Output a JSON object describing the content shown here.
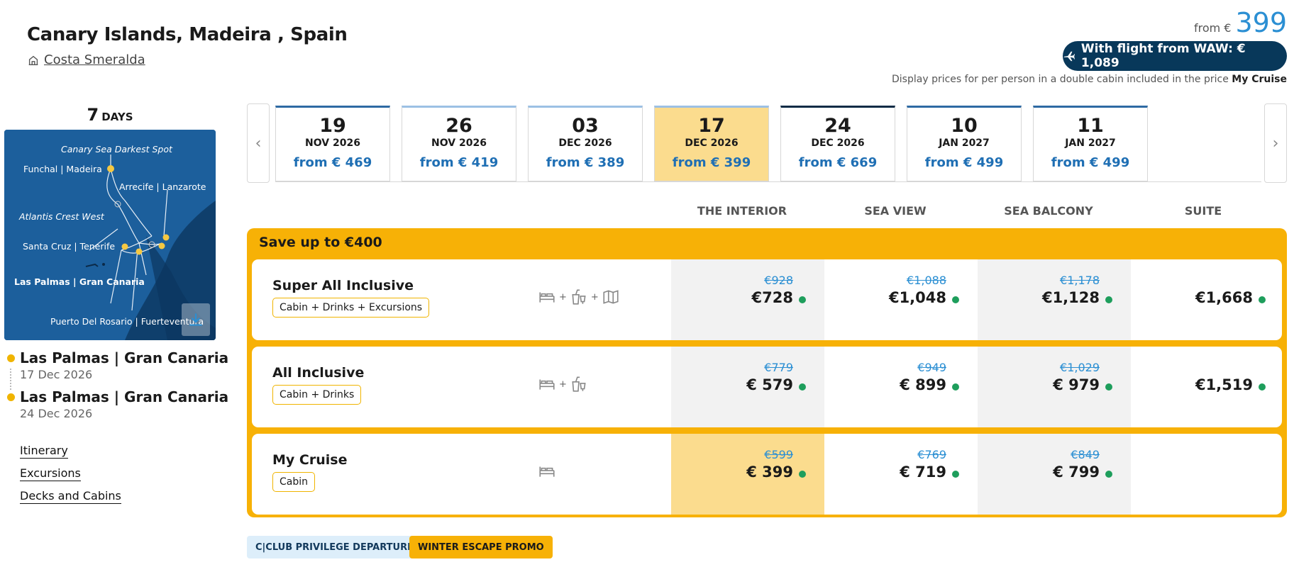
{
  "header": {
    "title": "Canary Islands, Madeira , Spain",
    "ship_name": "Costa Smeralda",
    "from_label": "from €",
    "from_price": "399",
    "flight_button": "With flight from WAW: € 1,089",
    "disclaimer_prefix": "Display prices for per person in a double cabin included in the price",
    "disclaimer_bold": "My Cruise"
  },
  "sidebar": {
    "days_number": "7",
    "days_unit": "DAYS",
    "map": {
      "labels": {
        "sea_spot": "Canary Sea Darkest Spot",
        "funchal": "Funchal | Madeira",
        "arrecife": "Arrecife | Lanzarote",
        "atlantis": "Atlantis Crest West",
        "santa_cruz": "Santa Cruz | Tenerife",
        "las_palmas": "Las Palmas | Gran Canaria",
        "puerto": "Puerto Del Rosario | Fuerteventura"
      }
    },
    "departure": {
      "port": "Las Palmas | Gran Canaria",
      "date": "17 Dec 2026"
    },
    "arrival": {
      "port": "Las Palmas | Gran Canaria",
      "date": "24 Dec 2026"
    },
    "links": [
      "Itinerary",
      "Excursions",
      "Decks and Cabins"
    ]
  },
  "dates": [
    {
      "day": "19",
      "month": "NOV 2026",
      "price": "from € 469"
    },
    {
      "day": "26",
      "month": "NOV 2026",
      "price": "from € 419"
    },
    {
      "day": "03",
      "month": "DEC 2026",
      "price": "from € 389"
    },
    {
      "day": "17",
      "month": "DEC 2026",
      "price": "from € 399"
    },
    {
      "day": "24",
      "month": "DEC 2026",
      "price": "from € 669"
    },
    {
      "day": "10",
      "month": "JAN 2027",
      "price": "from € 499"
    },
    {
      "day": "11",
      "month": "JAN 2027",
      "price": "from € 499"
    }
  ],
  "columns": [
    "THE INTERIOR",
    "SEA VIEW",
    "SEA BALCONY",
    "SUITE"
  ],
  "offer": {
    "save_label": "Save up to €400",
    "packages": [
      {
        "name": "Super All Inclusive",
        "tag": "Cabin + Drinks + Excursions",
        "prices": [
          {
            "old": "€928",
            "new": "€728"
          },
          {
            "old": "€1,088",
            "new": "€1,048"
          },
          {
            "old": "€1,178",
            "new": "€1,128"
          },
          {
            "old": "",
            "new": "€1,668"
          }
        ]
      },
      {
        "name": "All Inclusive",
        "tag": "Cabin + Drinks",
        "prices": [
          {
            "old": "€779",
            "new": "€ 579"
          },
          {
            "old": "€949",
            "new": "€ 899"
          },
          {
            "old": "€1,029",
            "new": "€ 979"
          },
          {
            "old": "",
            "new": "€1,519"
          }
        ]
      },
      {
        "name": "My Cruise",
        "tag": "Cabin",
        "prices": [
          {
            "old": "€599",
            "new": "€ 399"
          },
          {
            "old": "€769",
            "new": "€ 719"
          },
          {
            "old": "€849",
            "new": "€ 799"
          }
        ]
      }
    ]
  },
  "badges": {
    "club": "C|CLUB PRIVILEGE DEPARTURES",
    "promo": "WINTER ESCAPE PROMO"
  },
  "colors": {
    "accent_yellow": "#f7b106",
    "selected_date": "#fbdc8e",
    "price_blue": "#1f6fb4",
    "flight_btn": "#08385a",
    "available_dot": "#1e9e5c"
  }
}
